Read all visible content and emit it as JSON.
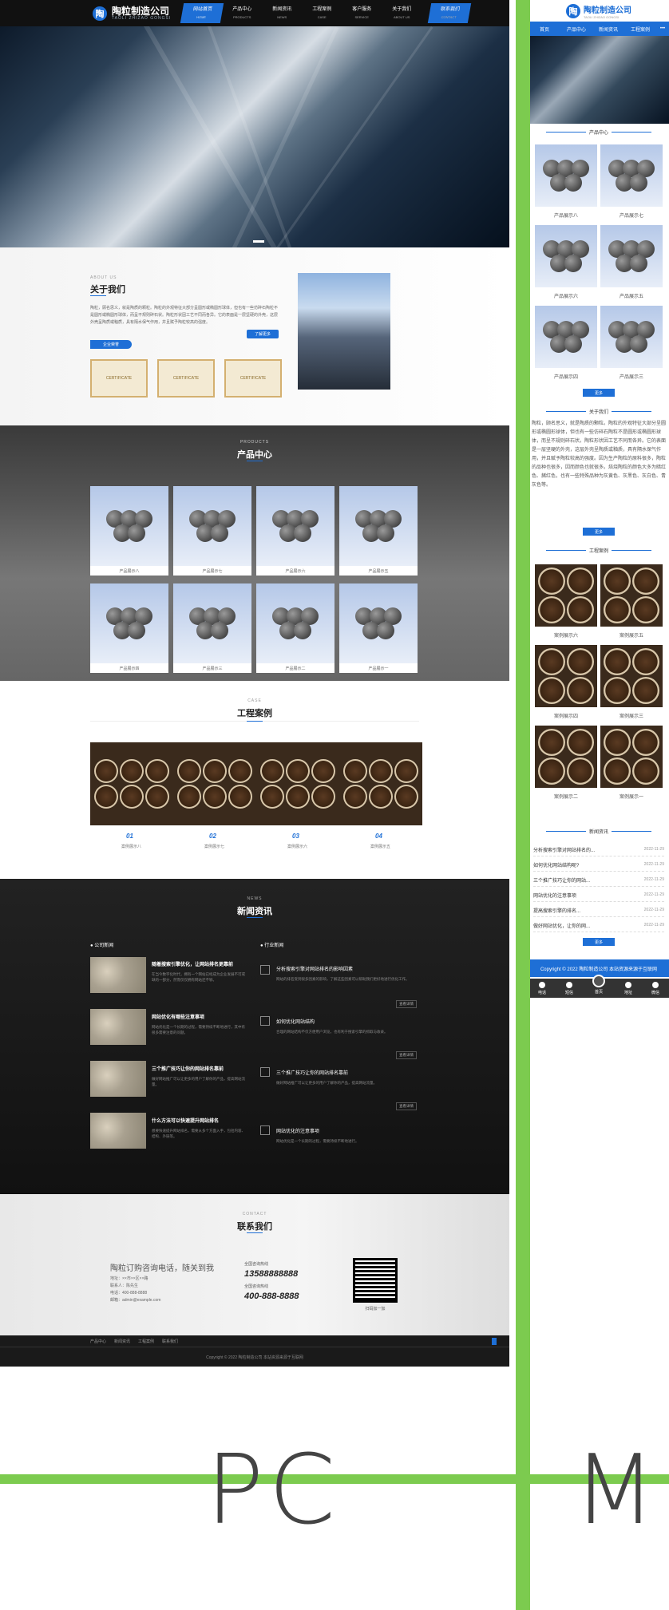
{
  "labels": {
    "pc": "PC",
    "m": "M"
  },
  "colors": {
    "frame": "#7ccb4f",
    "accent": "#1e6fd6"
  },
  "site": {
    "logo_glyph": "陶",
    "name": "陶粒制造公司",
    "name_en": "TAOLI ZHIZAO GONGSI"
  },
  "pc": {
    "nav": [
      {
        "cn": "网站首页",
        "en": "HOME"
      },
      {
        "cn": "产品中心",
        "en": "PRODUCTS"
      },
      {
        "cn": "新闻资讯",
        "en": "NEWS"
      },
      {
        "cn": "工程案例",
        "en": "CASE"
      },
      {
        "cn": "客户服务",
        "en": "SERVICE"
      },
      {
        "cn": "关于我们",
        "en": "ABOUT US"
      },
      {
        "cn": "联系我们",
        "en": "CONTACT"
      }
    ],
    "about": {
      "en": "ABOUT US",
      "cn": "关于我们",
      "text": "陶粒，顾名思义，就是陶质的颗粒。陶粒的外观特征大部分呈圆形或椭圆形球体，但也有一些仿碎石陶粒不是圆形或椭圆形球体，而呈不规则碎石状。陶粒形状因工艺不同而各异。它的表面是一层坚硬的外壳，这层外壳呈陶质或釉质，具有隔水保气作用，并且赋予陶粒较高的强度。",
      "more": "了解更多",
      "honor": "企业荣誉",
      "certs": [
        "CERTIFICATE",
        "CERTIFICATE",
        "CERTIFICATE"
      ]
    },
    "products": {
      "en": "PRODUCTS",
      "cn": "产品中心",
      "items": [
        "产品展示八",
        "产品展示七",
        "产品展示六",
        "产品展示五",
        "产品展示四",
        "产品展示三",
        "产品展示二",
        "产品展示一"
      ]
    },
    "cases": {
      "en": "CASE",
      "cn": "工程案例",
      "items": [
        {
          "num": "01",
          "label": "案例展示八"
        },
        {
          "num": "02",
          "label": "案例展示七"
        },
        {
          "num": "03",
          "label": "案例展示六"
        },
        {
          "num": "04",
          "label": "案例展示五"
        }
      ]
    },
    "news": {
      "en": "NEWS",
      "cn": "新闻资讯",
      "left_tab": "公司新闻",
      "right_tab": "行业新闻",
      "left": [
        {
          "title": "随着搜索引擎优化，让网站排名更靠前",
          "desc": "在当今数字化时代，拥有一个网站已经成为企业发展不可或缺的一部分，然而仅仅拥有网站还不够。"
        },
        {
          "title": "网站优化有哪些注意事项",
          "desc": "网站优化是一个长期的过程，需要持续不断地进行，其中有很多需要注意的问题。"
        },
        {
          "title": "三个推广技巧让你的网站排名靠前",
          "desc": "做好网站推广可以让更多的用户了解你的产品，提高网站流量。"
        },
        {
          "title": "什么方法可以快速提升网站排名",
          "desc": "想要快速提升网站排名，需要从多个方面入手，包括内容、结构、外链等。"
        }
      ],
      "right": [
        {
          "title": "分析搜索引擎对网站排名的影响因素",
          "desc": "网站的排名受到很多因素的影响，了解这些因素可以帮助我们更好地进行优化工作。",
          "more": "查看详情"
        },
        {
          "title": "如何优化网站结构",
          "desc": "合理的网站结构不仅方便用户浏览，也有利于搜索引擎的抓取与收录。",
          "more": "查看详情"
        },
        {
          "title": "三个推广技巧让你的网站排名靠前",
          "desc": "做好网站推广可以让更多的用户了解你的产品，提高网站流量。",
          "more": "查看详情"
        },
        {
          "title": "网站优化的注意事项",
          "desc": "网站优化是一个长期的过程，需要持续不断地进行。"
        }
      ]
    },
    "contact": {
      "en": "CONTACT",
      "cn": "联系我们",
      "slogan": "陶粒订购咨询电话，随关到我",
      "lines": [
        "地址：××市××区××路",
        "联系人：陈先生",
        "电话：400-888-8888",
        "邮箱：admin@example.com"
      ],
      "hotline_label": "全国咨询热线",
      "phone1": "13588888888",
      "phone2": "400-888-8888",
      "qr_label": "扫码加一加"
    },
    "footer": {
      "links": [
        "产品中心",
        "新闻资讯",
        "工程案例",
        "联系我们"
      ],
      "copy": "Copyright © 2022 陶粒制造公司 本站资源来源于互联网"
    }
  },
  "m": {
    "nav": [
      "首页",
      "产品中心",
      "新闻资讯",
      "工程案例"
    ],
    "sec_products": "产品中心",
    "products": [
      "产品展示八",
      "产品展示七",
      "产品展示六",
      "产品展示五",
      "产品展示四",
      "产品展示三"
    ],
    "more": "更多",
    "sec_about": "关于我们",
    "about": "陶粒，顾名思义，就是陶质的颗粒。陶粒的外观特征大部分呈圆形或椭圆形球体，但也有一些仿碎石陶粒不是圆形或椭圆形球体，而呈不规则碎石状。陶粒形状因工艺不同而各异。它的表面是一层坚硬的外壳，这层外壳呈陶质或釉质，具有隔水保气作用，并且赋予陶粒较高的强度。因为生产陶粒的原料很多，陶粒的品种也很多，因而颜色也就很多。焙烧陶粒的颜色大多为暗红色、赭红色，也有一些特殊品种为灰黄色、灰黑色、灰白色、青灰色等。",
    "sec_cases": "工程案例",
    "cases": [
      "案例展示六",
      "案例展示五",
      "案例展示四",
      "案例展示三",
      "案例展示二",
      "案例展示一"
    ],
    "sec_news": "新闻资讯",
    "news": [
      {
        "t": "分析搜索引擎对网站排名的...",
        "d": "2022-11-29"
      },
      {
        "t": "如何优化网站结构呢?",
        "d": "2022-11-29"
      },
      {
        "t": "三个推广技巧让你的网站...",
        "d": "2022-11-29"
      },
      {
        "t": "网站优化的注意事项",
        "d": "2022-11-29"
      },
      {
        "t": "提高搜索引擎的排名...",
        "d": "2022-11-29"
      },
      {
        "t": "做好网站优化，让你的网...",
        "d": "2022-11-29"
      }
    ],
    "copy": "Copyright © 2022 陶粒制造公司 本站资源来源于互联网",
    "bar": [
      "电话",
      "短信",
      "首页",
      "地址",
      "微信"
    ]
  }
}
